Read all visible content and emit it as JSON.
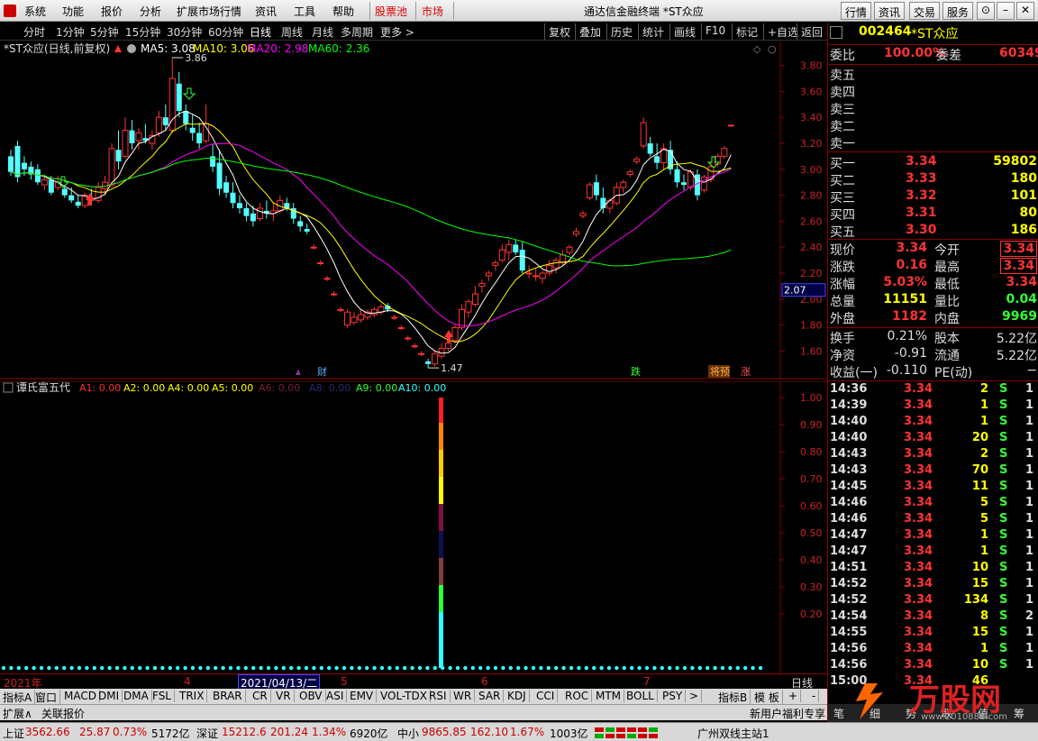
{
  "menu": {
    "items": [
      "系统",
      "功能",
      "报价",
      "分析",
      "扩展市场行情",
      "资讯",
      "工具",
      "帮助"
    ],
    "pool": "股票池",
    "market": "市场",
    "title": "通达信金融终端 *ST众应",
    "right_buttons": [
      "行情",
      "资讯",
      "交易",
      "服务"
    ]
  },
  "period_bar": {
    "items": [
      "分时",
      "1分钟",
      "5分钟",
      "15分钟",
      "30分钟",
      "60分钟",
      "日线",
      "周线",
      "月线",
      "多周期",
      "更多 >"
    ],
    "active": "日线",
    "tools": [
      "复权",
      "叠加",
      "历史",
      "统计",
      "画线",
      "F10",
      "标记",
      "+自选",
      "返回"
    ]
  },
  "main_chart": {
    "title": "*ST众应(日线,前复权)",
    "ma": [
      {
        "label": "MA5: 3.08",
        "color": "#ffffff"
      },
      {
        "label": "MA10: 3.06",
        "color": "#ffff00"
      },
      {
        "label": "MA20: 2.98",
        "color": "#ff00ff"
      },
      {
        "label": "MA60: 2.36",
        "color": "#00ff00"
      }
    ],
    "price_ticks": [
      "3.80",
      "3.60",
      "3.40",
      "3.20",
      "3.00",
      "2.80",
      "2.60",
      "2.40",
      "2.20",
      "2.00",
      "1.80",
      "1.60"
    ],
    "current_marker": "2.07",
    "high_label": "3.86",
    "low_label": "1.47",
    "event_labels": [
      "财",
      "跌",
      "将预",
      "涨"
    ]
  },
  "chart_data": {
    "type": "candlestick",
    "ylim": [
      1.45,
      3.95
    ],
    "candles": [
      [
        3.1,
        3.15,
        2.95,
        2.98
      ],
      [
        3.18,
        3.22,
        2.9,
        2.94
      ],
      [
        3.05,
        3.1,
        2.95,
        3.0
      ],
      [
        3.02,
        3.06,
        2.92,
        2.96
      ],
      [
        3.0,
        3.04,
        2.88,
        2.9
      ],
      [
        2.88,
        2.96,
        2.84,
        2.92
      ],
      [
        2.92,
        2.95,
        2.8,
        2.82
      ],
      [
        2.86,
        2.95,
        2.84,
        2.9
      ],
      [
        2.85,
        2.88,
        2.78,
        2.8
      ],
      [
        2.8,
        2.86,
        2.74,
        2.76
      ],
      [
        2.75,
        2.8,
        2.7,
        2.72
      ],
      [
        2.72,
        2.82,
        2.7,
        2.8
      ],
      [
        2.78,
        2.85,
        2.74,
        2.76
      ],
      [
        2.76,
        2.9,
        2.74,
        2.86
      ],
      [
        2.85,
        2.95,
        2.8,
        2.9
      ],
      [
        2.88,
        3.2,
        2.86,
        3.16
      ],
      [
        3.15,
        3.3,
        3.0,
        3.06
      ],
      [
        3.1,
        3.4,
        3.08,
        3.3
      ],
      [
        3.3,
        3.38,
        3.15,
        3.2
      ],
      [
        3.22,
        3.32,
        3.15,
        3.28
      ],
      [
        3.24,
        3.35,
        3.2,
        3.22
      ],
      [
        3.2,
        3.3,
        3.15,
        3.26
      ],
      [
        3.28,
        3.45,
        3.25,
        3.4
      ],
      [
        3.4,
        3.5,
        3.3,
        3.34
      ],
      [
        3.3,
        3.86,
        3.28,
        3.7
      ],
      [
        3.66,
        3.75,
        3.4,
        3.45
      ],
      [
        3.45,
        3.5,
        3.3,
        3.35
      ],
      [
        3.32,
        3.42,
        3.22,
        3.28
      ],
      [
        3.28,
        3.36,
        3.16,
        3.2
      ],
      [
        3.22,
        3.5,
        3.2,
        3.35
      ],
      [
        3.1,
        3.2,
        2.98,
        3.02
      ],
      [
        3.05,
        3.15,
        2.8,
        2.85
      ],
      [
        2.9,
        2.95,
        2.78,
        2.82
      ],
      [
        2.82,
        2.9,
        2.7,
        2.74
      ],
      [
        2.74,
        2.8,
        2.66,
        2.7
      ],
      [
        2.7,
        2.74,
        2.6,
        2.64
      ],
      [
        2.66,
        2.72,
        2.56,
        2.6
      ],
      [
        2.62,
        2.74,
        2.6,
        2.7
      ],
      [
        2.68,
        2.76,
        2.62,
        2.66
      ],
      [
        2.66,
        2.74,
        2.6,
        2.68
      ],
      [
        2.68,
        2.8,
        2.66,
        2.76
      ],
      [
        2.74,
        2.78,
        2.68,
        2.7
      ],
      [
        2.7,
        2.74,
        2.58,
        2.62
      ],
      [
        2.6,
        2.64,
        2.52,
        2.56
      ],
      [
        2.54,
        2.58,
        2.5,
        2.52
      ],
      [
        2.4,
        2.42,
        2.38,
        2.4
      ],
      [
        2.28,
        2.3,
        2.26,
        2.28
      ],
      [
        2.16,
        2.18,
        2.14,
        2.16
      ],
      [
        2.04,
        2.06,
        2.02,
        2.04
      ],
      [
        1.92,
        1.94,
        1.9,
        1.92
      ],
      [
        1.8,
        1.92,
        1.78,
        1.9
      ],
      [
        1.82,
        1.9,
        1.8,
        1.86
      ],
      [
        1.84,
        1.92,
        1.82,
        1.88
      ],
      [
        1.86,
        1.92,
        1.84,
        1.9
      ],
      [
        1.88,
        1.94,
        1.86,
        1.92
      ],
      [
        1.9,
        1.96,
        1.88,
        1.94
      ],
      [
        1.95,
        1.97,
        1.9,
        1.92
      ],
      [
        1.86,
        1.88,
        1.84,
        1.86
      ],
      [
        1.78,
        1.8,
        1.76,
        1.78
      ],
      [
        1.7,
        1.72,
        1.68,
        1.7
      ],
      [
        1.64,
        1.66,
        1.62,
        1.64
      ],
      [
        1.58,
        1.6,
        1.56,
        1.58
      ],
      [
        1.52,
        1.54,
        1.47,
        1.5
      ],
      [
        1.5,
        1.6,
        1.48,
        1.58
      ],
      [
        1.56,
        1.66,
        1.54,
        1.62
      ],
      [
        1.62,
        1.7,
        1.6,
        1.66
      ],
      [
        1.68,
        1.8,
        1.66,
        1.78
      ],
      [
        1.78,
        1.96,
        1.76,
        1.92
      ],
      [
        1.9,
        2.0,
        1.86,
        1.98
      ],
      [
        1.96,
        2.1,
        1.94,
        2.04
      ],
      [
        2.1,
        2.15,
        2.05,
        2.12
      ],
      [
        2.18,
        2.22,
        2.14,
        2.2
      ],
      [
        2.26,
        2.3,
        2.22,
        2.28
      ],
      [
        2.3,
        2.42,
        2.28,
        2.38
      ],
      [
        2.36,
        2.46,
        2.3,
        2.42
      ],
      [
        2.42,
        2.46,
        2.34,
        2.36
      ],
      [
        2.38,
        2.44,
        2.2,
        2.22
      ],
      [
        2.2,
        2.26,
        2.16,
        2.2
      ],
      [
        2.18,
        2.24,
        2.14,
        2.18
      ],
      [
        2.16,
        2.22,
        2.12,
        2.2
      ],
      [
        2.2,
        2.3,
        2.18,
        2.26
      ],
      [
        2.24,
        2.32,
        2.2,
        2.3
      ],
      [
        2.28,
        2.38,
        2.26,
        2.34
      ],
      [
        2.36,
        2.42,
        2.34,
        2.4
      ],
      [
        2.5,
        2.55,
        2.48,
        2.52
      ],
      [
        2.64,
        2.68,
        2.62,
        2.66
      ],
      [
        2.78,
        2.9,
        2.76,
        2.88
      ],
      [
        2.9,
        2.96,
        2.76,
        2.8
      ],
      [
        2.78,
        2.86,
        2.66,
        2.7
      ],
      [
        2.7,
        2.78,
        2.66,
        2.76
      ],
      [
        2.74,
        2.9,
        2.72,
        2.86
      ],
      [
        2.86,
        2.92,
        2.82,
        2.9
      ],
      [
        2.96,
        3.0,
        2.94,
        2.98
      ],
      [
        3.06,
        3.1,
        3.04,
        3.08
      ],
      [
        3.18,
        3.4,
        3.16,
        3.36
      ],
      [
        3.2,
        3.25,
        3.1,
        3.12
      ],
      [
        3.1,
        3.2,
        3.0,
        3.05
      ],
      [
        3.05,
        3.2,
        3.0,
        3.16
      ],
      [
        3.15,
        3.22,
        2.96,
        3.0
      ],
      [
        3.0,
        3.06,
        2.86,
        2.9
      ],
      [
        2.9,
        2.96,
        2.84,
        2.88
      ],
      [
        2.86,
        3.0,
        2.84,
        2.98
      ],
      [
        2.96,
        3.0,
        2.76,
        2.8
      ],
      [
        2.84,
        2.96,
        2.82,
        2.94
      ],
      [
        2.92,
        3.06,
        2.9,
        3.02
      ],
      [
        3.04,
        3.12,
        3.02,
        3.1
      ],
      [
        3.1,
        3.18,
        3.08,
        3.16
      ],
      [
        3.34,
        3.34,
        3.34,
        3.34
      ]
    ]
  },
  "indicator": {
    "title": "谭氏富五代",
    "items": [
      {
        "label": "A1: 0.00",
        "color": "#ff3030"
      },
      {
        "label": "A2: 0.00",
        "color": "#ffff00"
      },
      {
        "label": "A4: 0.00",
        "color": "#ffff00"
      },
      {
        "label": "A5: 0.00",
        "color": "#ffff00"
      },
      {
        "label": "A6: 0.00",
        "color": "#7a1a3a"
      },
      {
        "label": "A8: 0.00",
        "color": "#2a2a6a"
      },
      {
        "label": "A9: 0.00",
        "color": "#33ff33"
      },
      {
        "label": "A10: 0.00",
        "color": "#33ffff"
      }
    ],
    "ticks": [
      "1.00",
      "0.90",
      "0.80",
      "0.70",
      "0.60",
      "0.50",
      "0.40",
      "0.30",
      "0.20"
    ]
  },
  "x_axis": {
    "year": "2021年",
    "months": [
      "4",
      "5",
      "6",
      "7"
    ],
    "selected": "2021/04/13/二",
    "period": "日线"
  },
  "tabs": {
    "items": [
      "指标A",
      "窗口",
      "MACD",
      "DMI",
      "DMA",
      "FSL",
      "TRIX",
      "BRAR",
      "CR",
      "VR",
      "OBV",
      "ASI",
      "EMV",
      "VOL-TDX",
      "RSI",
      "WR",
      "SAR",
      "KDJ",
      "CCI",
      "ROC",
      "MTM",
      "BOLL",
      "PSY",
      ">"
    ],
    "right": [
      "指标B",
      "模 板",
      "+",
      "-"
    ]
  },
  "ext_bar": {
    "left": "扩展∧",
    "quote": "关联报价",
    "promo": "新用户福利专享"
  },
  "status": {
    "sh_label": "上证",
    "sh_val": "3562.66",
    "sh_chg": "25.87",
    "sh_pct": "0.73%",
    "sh_amt": "5172亿",
    "sz_label": "深证",
    "sz_val": "15212.6",
    "sz_chg": "201.24",
    "sz_pct": "1.34%",
    "sz_amt": "6920亿",
    "zx_label": "中小",
    "zx_val": "9865.85",
    "zx_chg": "162.10",
    "zx_pct": "1.67%",
    "zx_amt": "1003亿",
    "server": "广州双线主站1"
  },
  "quote": {
    "code": "002464",
    "name": "*ST众应",
    "weibi_label": "委比",
    "weibi": "100.00%",
    "weicha_label": "委差",
    "weicha": "60349",
    "sell": [
      "卖五",
      "卖四",
      "卖三",
      "卖二",
      "卖一"
    ],
    "buy": [
      {
        "label": "买一",
        "price": "3.34",
        "vol": "59802"
      },
      {
        "label": "买二",
        "price": "3.33",
        "vol": "180"
      },
      {
        "label": "买三",
        "price": "3.32",
        "vol": "101"
      },
      {
        "label": "买四",
        "price": "3.31",
        "vol": "80"
      },
      {
        "label": "买五",
        "price": "3.30",
        "vol": "186"
      }
    ],
    "stats": [
      {
        "l1": "现价",
        "v1": "3.34",
        "l2": "今开",
        "v2": "3.34",
        "c1": "red2",
        "c2": "red2",
        "box": true
      },
      {
        "l1": "涨跌",
        "v1": "0.16",
        "l2": "最高",
        "v2": "3.34",
        "c1": "red2",
        "c2": "red2",
        "box": true
      },
      {
        "l1": "涨幅",
        "v1": "5.03%",
        "l2": "最低",
        "v2": "3.34",
        "c1": "red2",
        "c2": "red2",
        "box": false
      },
      {
        "l1": "总量",
        "v1": "11151",
        "l2": "量比",
        "v2": "0.04",
        "c1": "yel",
        "c2": "grn",
        "box": false
      },
      {
        "l1": "外盘",
        "v1": "1182",
        "l2": "内盘",
        "v2": "9969",
        "c1": "red2",
        "c2": "grn",
        "box": false
      }
    ],
    "stats2": [
      {
        "l1": "换手",
        "v1": "0.21%",
        "l2": "股本",
        "v2": "5.22亿"
      },
      {
        "l1": "净资",
        "v1": "-0.91",
        "l2": "流通",
        "v2": "5.22亿"
      },
      {
        "l1": "收益(一)",
        "v1": "-0.110",
        "l2": "PE(动)",
        "v2": "−"
      }
    ]
  },
  "ticks": [
    {
      "t": "14:36",
      "p": "3.34",
      "v": "2",
      "s": "S",
      "n": "1"
    },
    {
      "t": "14:39",
      "p": "3.34",
      "v": "1",
      "s": "S",
      "n": "1"
    },
    {
      "t": "14:40",
      "p": "3.34",
      "v": "1",
      "s": "S",
      "n": "1"
    },
    {
      "t": "14:40",
      "p": "3.34",
      "v": "20",
      "s": "S",
      "n": "1"
    },
    {
      "t": "14:43",
      "p": "3.34",
      "v": "2",
      "s": "S",
      "n": "1"
    },
    {
      "t": "14:43",
      "p": "3.34",
      "v": "70",
      "s": "S",
      "n": "1"
    },
    {
      "t": "14:45",
      "p": "3.34",
      "v": "11",
      "s": "S",
      "n": "1"
    },
    {
      "t": "14:46",
      "p": "3.34",
      "v": "5",
      "s": "S",
      "n": "1"
    },
    {
      "t": "14:46",
      "p": "3.34",
      "v": "5",
      "s": "S",
      "n": "1"
    },
    {
      "t": "14:47",
      "p": "3.34",
      "v": "1",
      "s": "S",
      "n": "1"
    },
    {
      "t": "14:47",
      "p": "3.34",
      "v": "1",
      "s": "S",
      "n": "1"
    },
    {
      "t": "14:51",
      "p": "3.34",
      "v": "10",
      "s": "S",
      "n": "1"
    },
    {
      "t": "14:52",
      "p": "3.34",
      "v": "15",
      "s": "S",
      "n": "1"
    },
    {
      "t": "14:52",
      "p": "3.34",
      "v": "134",
      "s": "S",
      "n": "1"
    },
    {
      "t": "14:54",
      "p": "3.34",
      "v": "8",
      "s": "S",
      "n": "2"
    },
    {
      "t": "14:55",
      "p": "3.34",
      "v": "15",
      "s": "S",
      "n": "1"
    },
    {
      "t": "14:56",
      "p": "3.34",
      "v": "1",
      "s": "S",
      "n": "1"
    },
    {
      "t": "14:56",
      "p": "3.34",
      "v": "10",
      "s": "S",
      "n": "1"
    },
    {
      "t": "15:00",
      "p": "3.34",
      "v": "46",
      "s": "",
      "n": ""
    }
  ],
  "bottom_tabs": [
    "笔",
    "细",
    "势",
    "联",
    "值",
    "筹"
  ],
  "watermark": {
    "brand": "万股网",
    "url": "www.2010888.com"
  },
  "colors": {
    "up": "#ff3333",
    "down": "#55ffff",
    "ma5": "#ffffff",
    "ma10": "#ffff00",
    "ma20": "#ff00ff",
    "ma60": "#00ff00",
    "grid": "#800000"
  }
}
